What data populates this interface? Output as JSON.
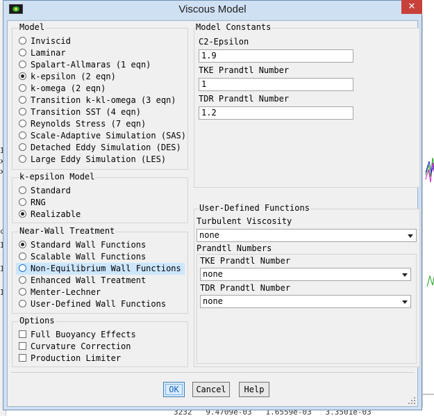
{
  "window": {
    "title": "Viscous Model",
    "close_glyph": "✕"
  },
  "model": {
    "label": "Model",
    "options": [
      {
        "label": "Inviscid",
        "selected": false
      },
      {
        "label": "Laminar",
        "selected": false
      },
      {
        "label": "Spalart-Allmaras (1 eqn)",
        "selected": false
      },
      {
        "label": "k-epsilon (2 eqn)",
        "selected": true
      },
      {
        "label": "k-omega (2 eqn)",
        "selected": false
      },
      {
        "label": "Transition k-kl-omega (3 eqn)",
        "selected": false
      },
      {
        "label": "Transition SST (4 eqn)",
        "selected": false
      },
      {
        "label": "Reynolds Stress (7 eqn)",
        "selected": false
      },
      {
        "label": "Scale-Adaptive Simulation (SAS)",
        "selected": false
      },
      {
        "label": "Detached Eddy Simulation (DES)",
        "selected": false
      },
      {
        "label": "Large Eddy Simulation (LES)",
        "selected": false
      }
    ]
  },
  "k_epsilon_model": {
    "label": "k-epsilon Model",
    "options": [
      {
        "label": "Standard",
        "selected": false
      },
      {
        "label": "RNG",
        "selected": false
      },
      {
        "label": "Realizable",
        "selected": true
      }
    ]
  },
  "near_wall": {
    "label": "Near-Wall Treatment",
    "options": [
      {
        "label": "Standard Wall Functions",
        "selected": true
      },
      {
        "label": "Scalable Wall Functions",
        "selected": false
      },
      {
        "label": "Non-Equilibrium Wall Functions",
        "selected": false,
        "highlighted": true
      },
      {
        "label": "Enhanced Wall Treatment",
        "selected": false
      },
      {
        "label": "Menter-Lechner",
        "selected": false
      },
      {
        "label": "User-Defined Wall Functions",
        "selected": false
      }
    ]
  },
  "options": {
    "label": "Options",
    "items": [
      {
        "label": "Full Buoyancy Effects",
        "checked": false
      },
      {
        "label": "Curvature Correction",
        "checked": false
      },
      {
        "label": "Production Limiter",
        "checked": false
      }
    ]
  },
  "model_constants": {
    "label": "Model Constants",
    "fields": [
      {
        "label": "C2-Epsilon",
        "value": "1.9"
      },
      {
        "label": "TKE Prandtl Number",
        "value": "1"
      },
      {
        "label": "TDR Prandtl Number",
        "value": "1.2"
      }
    ]
  },
  "udf": {
    "label": "User-Defined Functions",
    "turbulent_viscosity": {
      "label": "Turbulent Viscosity",
      "value": "none"
    },
    "prandtl_numbers": {
      "label": "Prandtl Numbers",
      "tke": {
        "label": "TKE Prandtl Number",
        "value": "none"
      },
      "tdr": {
        "label": "TDR Prandtl Number",
        "value": "none"
      }
    }
  },
  "buttons": {
    "ok": "OK",
    "cancel": "Cancel",
    "help": "Help"
  },
  "background": {
    "bottom_text": "3232   9.4709e-03   1.6559e-03   3.3501e-03",
    "left_chars": [
      "I",
      "x",
      "x",
      "c",
      "I",
      "I",
      "I"
    ]
  },
  "colors": {
    "title_bar": "#cfe0f2",
    "close_button": "#c7413a",
    "highlight_row": "#cce6ff",
    "ok_button": "#d9ecff"
  }
}
